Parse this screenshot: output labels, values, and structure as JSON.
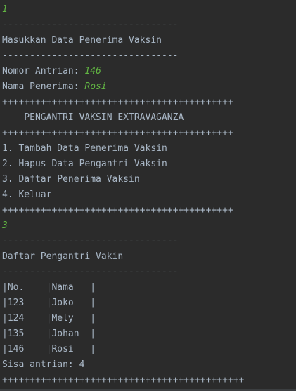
{
  "console": {
    "choice_1": "1",
    "dashes_1": "--------------------------------",
    "enter_data_header": "Masukkan Data Penerima Vaksin",
    "dashes_2": "--------------------------------",
    "queue_number_label": "Nomor Antrian: ",
    "queue_number_value": "146",
    "name_label": "Nama Penerima: ",
    "name_value": "Rosi",
    "plus_1": "++++++++++++++++++++++++++++++++++++++++++",
    "menu_title": "    PENGANTRI VAKSIN EXTRAVAGANZA",
    "plus_2": "++++++++++++++++++++++++++++++++++++++++++",
    "menu_items": [
      "1. Tambah Data Penerima Vaksin",
      "2. Hapus Data Pengantri Vaksin",
      "3. Daftar Penerima Vaksin",
      "4. Keluar"
    ],
    "plus_3": "++++++++++++++++++++++++++++++++++++++++++",
    "choice_2": "3",
    "dashes_3": "--------------------------------",
    "list_header": "Daftar Pengantri Vakin",
    "dashes_4": "--------------------------------",
    "table_rows": [
      "|No.    |Nama   |",
      "|123    |Joko   |",
      "|124    |Mely   |",
      "|135    |Johan  |",
      "|146    |Rosi   |"
    ],
    "remaining": "Sisa antrian: 4",
    "plus_4": "++++++++++++++++++++++++++++++++++++++++++++"
  },
  "colors": {
    "background": "#2b2b2b",
    "output_text": "#a9b7c6",
    "user_input": "#62b543"
  }
}
